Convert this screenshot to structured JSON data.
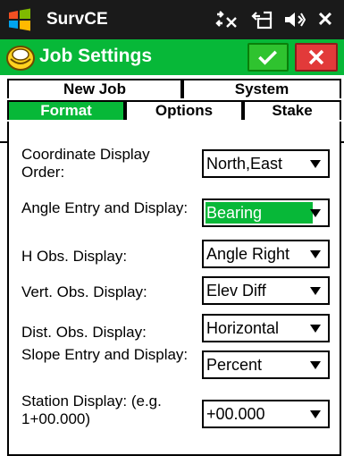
{
  "os": {
    "title": "SurvCE",
    "icons": [
      "windows-logo-icon",
      "sync-icon",
      "network-icon",
      "volume-icon",
      "close-icon"
    ],
    "close_glyph": "✕"
  },
  "app": {
    "title": "Job Settings",
    "accent_color": "#07b838",
    "ok_color": "#2fc32f",
    "cancel_color": "#e23a3a"
  },
  "tabs": {
    "row1": [
      {
        "label": "New Job"
      },
      {
        "label": "System"
      }
    ],
    "row2": [
      {
        "label": "Format",
        "active": true
      },
      {
        "label": "Options"
      },
      {
        "label": "Stake"
      }
    ]
  },
  "settings": [
    {
      "label": "Coordinate Display Order:",
      "value": "North,East",
      "selected": false
    },
    {
      "label": "Angle Entry and Display:",
      "value": "Bearing",
      "selected": true
    },
    {
      "label": "H Obs. Display:",
      "value": "Angle Right",
      "selected": false
    },
    {
      "label": "Vert. Obs. Display:",
      "value": "Elev Diff",
      "selected": false
    },
    {
      "label": "Dist. Obs. Display:",
      "value": "Horizontal",
      "selected": false
    },
    {
      "label": "Slope Entry and Display:",
      "value": "Percent",
      "selected": false
    },
    {
      "label": "Station Display: (e.g. 1+00.000)",
      "value": "+00.000",
      "selected": false
    }
  ]
}
